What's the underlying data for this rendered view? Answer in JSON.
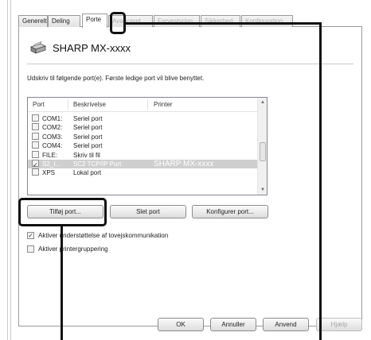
{
  "tabs": [
    {
      "label": "Generelt"
    },
    {
      "label": "Deling"
    },
    {
      "label": "Porte",
      "active": true
    },
    {
      "label": "Avanceret"
    },
    {
      "label": "Farvestyring"
    },
    {
      "label": "Sikkerhed"
    },
    {
      "label": "Konfiguration"
    }
  ],
  "printer": {
    "name": "SHARP MX-xxxx",
    "icon": "printer-icon"
  },
  "instruction": "Udskriv til følgende port(e). Første ledige port vil blive benyttet.",
  "port_list": {
    "columns": [
      "Port",
      "Beskrivelse",
      "Printer"
    ],
    "rows": [
      {
        "checked": false,
        "port": "COM1:",
        "description": "Seriel port",
        "printer": ""
      },
      {
        "checked": false,
        "port": "COM2:",
        "description": "Seriel port",
        "printer": ""
      },
      {
        "checked": false,
        "port": "COM3:",
        "description": "Seriel port",
        "printer": ""
      },
      {
        "checked": false,
        "port": "COM4:",
        "description": "Seriel port",
        "printer": ""
      },
      {
        "checked": false,
        "port": "FILE:",
        "description": "Skriv til fil",
        "printer": ""
      },
      {
        "checked": true,
        "port": "S2_I...",
        "description": "SC2 TCP/IP Port",
        "printer": "SHARP MX-xxxx",
        "selected": true
      },
      {
        "checked": false,
        "port": "XPS",
        "description": "Lokal port",
        "printer": ""
      }
    ]
  },
  "port_buttons": {
    "add": "Tilføj port...",
    "delete": "Slet port",
    "configure": "Konfigurer port..."
  },
  "options": {
    "bidirectional": {
      "label": "Aktiver understøttelse af tovejskommunikation",
      "checked": true
    },
    "pooling": {
      "label": "Aktiver printergruppering",
      "checked": false
    }
  },
  "dialog_buttons": {
    "ok": "OK",
    "cancel": "Annuller",
    "apply": "Anvend",
    "help": "Hjælp"
  },
  "colors": {
    "callout": "#111111",
    "selection": "#cfcfcf"
  }
}
